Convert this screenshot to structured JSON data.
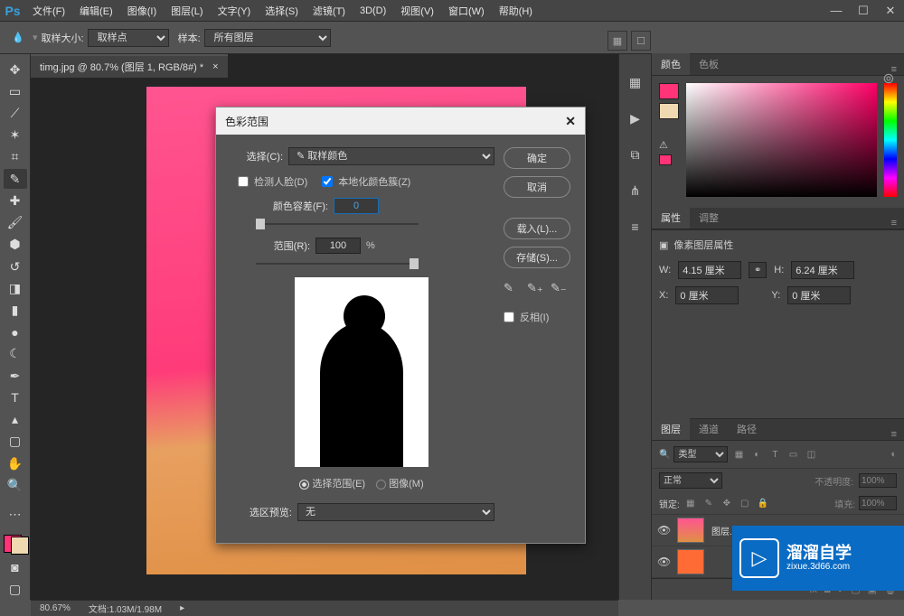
{
  "app": {
    "logo": "Ps"
  },
  "menu": {
    "file": "文件(F)",
    "edit": "编辑(E)",
    "image": "图像(I)",
    "layer": "图层(L)",
    "type": "文字(Y)",
    "select": "选择(S)",
    "filter": "滤镜(T)",
    "threed": "3D(D)",
    "view": "视图(V)",
    "window": "窗口(W)",
    "help": "帮助(H)"
  },
  "options": {
    "sample_size_label": "取样大小:",
    "sample_size_value": "取样点",
    "sample_label": "样本:",
    "sample_value": "所有图层"
  },
  "document": {
    "tab": "timg.jpg @ 80.7% (图层 1, RGB/8#) *",
    "close": "×"
  },
  "dialog": {
    "title": "色彩范围",
    "select_label": "选择(C):",
    "select_value": "✎ 取样颜色",
    "detect_faces": "检测人脸(D)",
    "localize": "本地化颜色簇(Z)",
    "fuzziness_label": "颜色容差(F):",
    "fuzziness_value": "0",
    "range_label": "范围(R):",
    "range_value": "100",
    "range_pct": "%",
    "radio_selection": "选择范围(E)",
    "radio_image": "图像(M)",
    "preview_label": "选区预览:",
    "preview_value": "无",
    "ok": "确定",
    "cancel": "取消",
    "load": "载入(L)...",
    "save": "存储(S)...",
    "invert": "反相(I)"
  },
  "panels": {
    "color_tab": "颜色",
    "swatches_tab": "色板",
    "props_tab": "属性",
    "adjust_tab": "调整",
    "pixel_layer": "像素图层属性",
    "w_label": "W:",
    "w_value": "4.15 厘米",
    "h_label": "H:",
    "h_value": "6.24 厘米",
    "x_label": "X:",
    "x_value": "0 厘米",
    "y_label": "Y:",
    "y_value": "0 厘米",
    "layers_tab": "图层",
    "channels_tab": "通道",
    "paths_tab": "路径",
    "kind_label": "类型",
    "blend_mode": "正常",
    "opacity_label": "不透明度:",
    "opacity_value": "100%",
    "lock_label": "锁定:",
    "fill_label": "填充:",
    "fill_value": "100%",
    "layer1": "图层...",
    "bg_layer": ""
  },
  "status": {
    "zoom": "80.67%",
    "doc_label": "文档:",
    "doc_size": "1.03M/1.98M"
  },
  "watermark": {
    "brand": "溜溜自学",
    "url": "zixue.3d66.com"
  }
}
